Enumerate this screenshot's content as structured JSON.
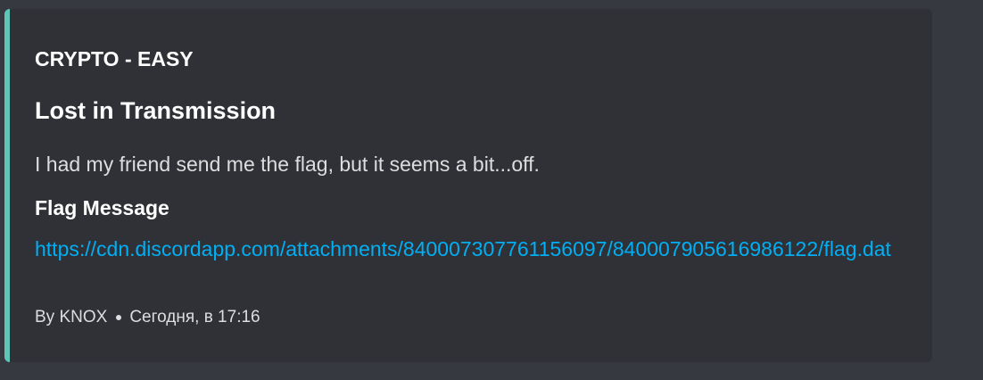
{
  "embed": {
    "accent_color": "#61c4b9",
    "author": "CRYPTO - EASY",
    "title": "Lost in Transmission",
    "description": "I had my friend send me the flag, but it seems a bit...off.",
    "field": {
      "name": "Flag Message",
      "value": "https://cdn.discordapp.com/attachments/840007307761156097/840007905616986122/flag.dat"
    },
    "footer": {
      "author": "By KNOX",
      "separator_icon": "bullet-dot",
      "timestamp": "Сегодня, в 17:16"
    }
  }
}
